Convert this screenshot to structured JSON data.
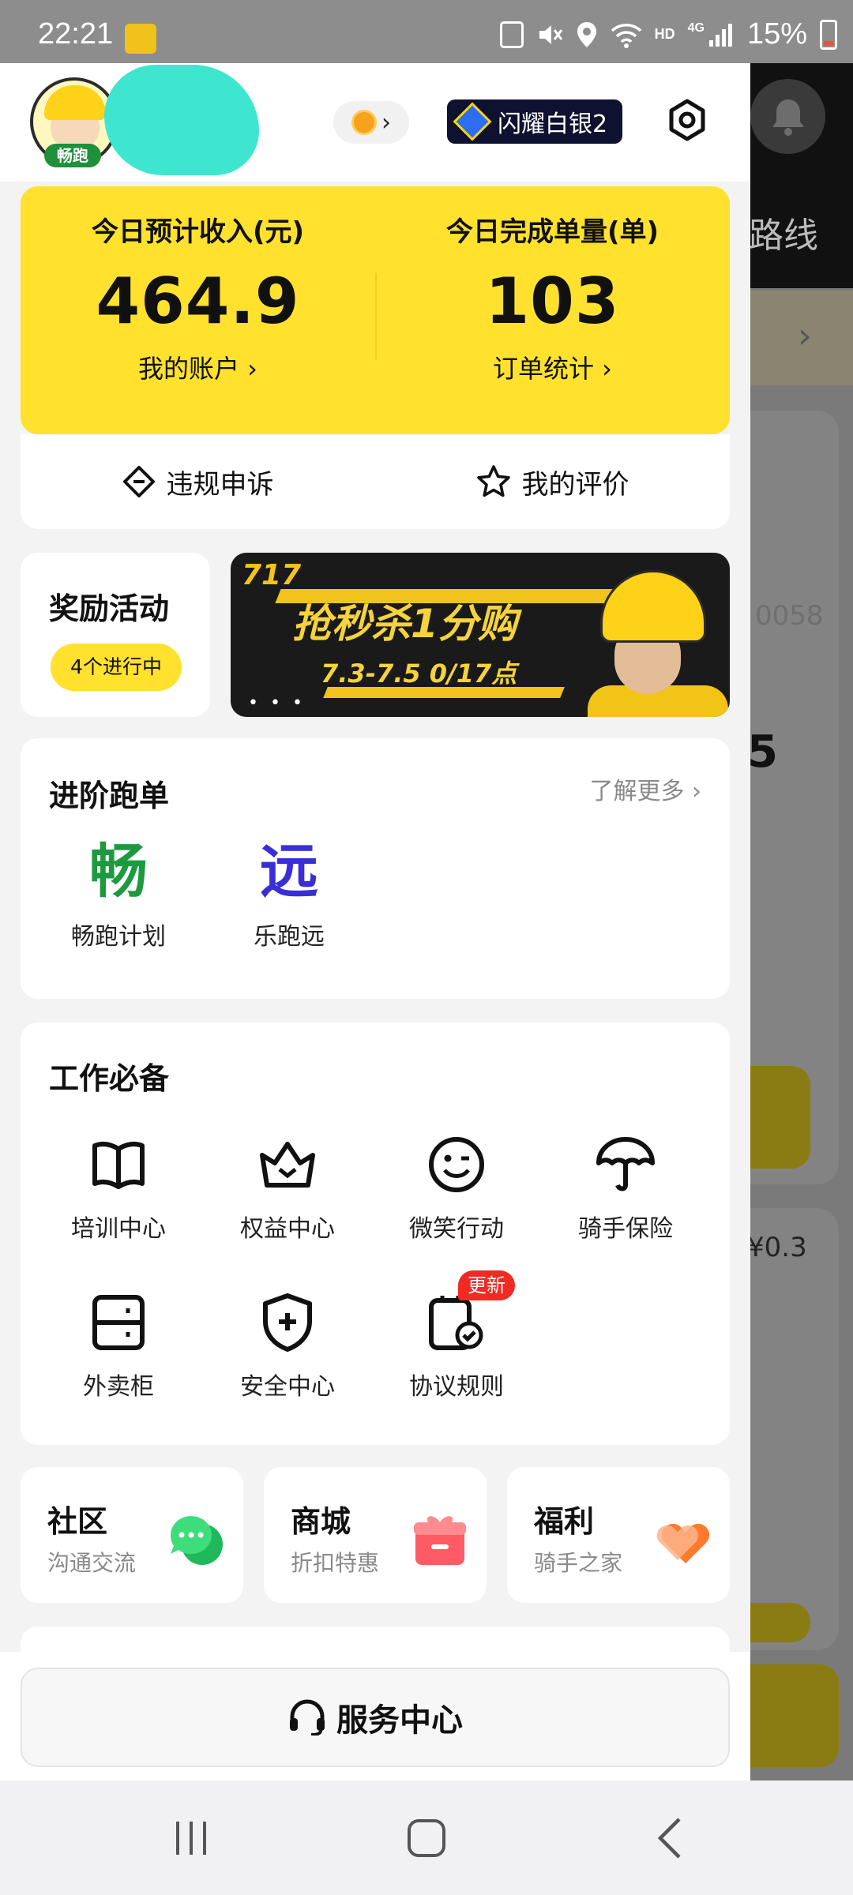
{
  "status_bar": {
    "time": "22:21",
    "network": "4G",
    "hd": "HD",
    "battery": "15%"
  },
  "header": {
    "avatar_badge": "畅跑",
    "rank_label": "闪耀白银2"
  },
  "stats": {
    "income_label": "今日预计收入(元)",
    "income_value": "464.9",
    "account_link": "我的账户 ›",
    "orders_label": "今日完成单量(单)",
    "orders_value": "103",
    "orders_link": "订单统计 ›"
  },
  "quick_actions": {
    "appeal": "违规申诉",
    "reviews": "我的评价"
  },
  "reward": {
    "title": "奖励活动",
    "status": "4个进行中"
  },
  "banner": {
    "tag": "717",
    "title": "抢秒杀1分购",
    "subtitle": "7.3-7.5 0/17点"
  },
  "advanced": {
    "title": "进阶跑单",
    "more": "了解更多 ›",
    "items": [
      {
        "glyph": "畅",
        "label": "畅跑计划",
        "color": "#1d9a3f"
      },
      {
        "glyph": "远",
        "label": "乐跑远",
        "color": "#3a2fd6"
      }
    ]
  },
  "tools": {
    "title": "工作必备",
    "items": [
      {
        "label": "培训中心",
        "icon": "book-icon"
      },
      {
        "label": "权益中心",
        "icon": "crown-icon"
      },
      {
        "label": "微笑行动",
        "icon": "smile-icon"
      },
      {
        "label": "骑手保险",
        "icon": "umbrella-icon"
      },
      {
        "label": "外卖柜",
        "icon": "locker-icon"
      },
      {
        "label": "安全中心",
        "icon": "shield-icon"
      },
      {
        "label": "协议规则",
        "icon": "agreement-icon",
        "badge": "更新"
      }
    ]
  },
  "mini_cards": [
    {
      "title": "社区",
      "sub": "沟通交流",
      "icon": "chat-bubble-icon",
      "color": "#2fd26b"
    },
    {
      "title": "商城",
      "sub": "折扣特惠",
      "icon": "gift-box-icon",
      "color": "#ff5b60"
    },
    {
      "title": "福利",
      "sub": "骑手之家",
      "icon": "heart-icon",
      "color": "#ff8a3a"
    }
  ],
  "service": {
    "label": "服务中心"
  },
  "background_app": {
    "route": "路线",
    "big_text": "5",
    "price": "¥0.3",
    "id_fragment": "0058"
  }
}
